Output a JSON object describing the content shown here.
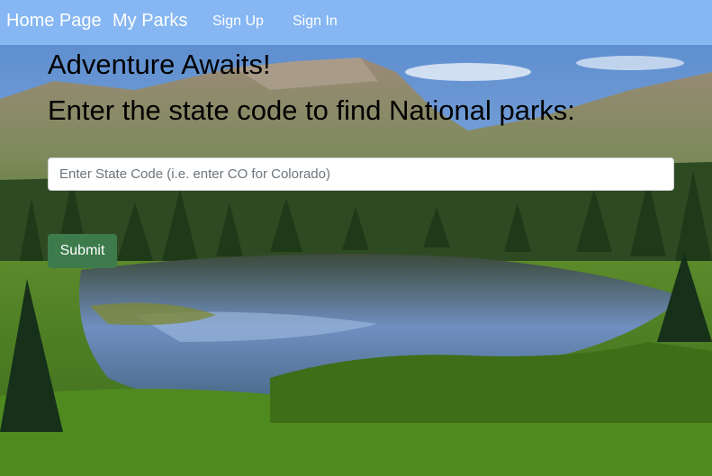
{
  "navbar": {
    "brand": "Home Page",
    "links": [
      {
        "label": "My Parks"
      },
      {
        "label": "Sign Up"
      },
      {
        "label": "Sign In"
      }
    ],
    "background": "#86b7f3"
  },
  "hero": {
    "title": "Adventure Awaits!",
    "subtitle": "Enter the state code to find National parks:",
    "background_image": "mountain lake forest landscape"
  },
  "form": {
    "state_input": {
      "value": "",
      "placeholder": "Enter State Code (i.e. enter CO for Colorado)"
    },
    "submit_label": "Submit",
    "submit_color": "#3d7b4c"
  }
}
